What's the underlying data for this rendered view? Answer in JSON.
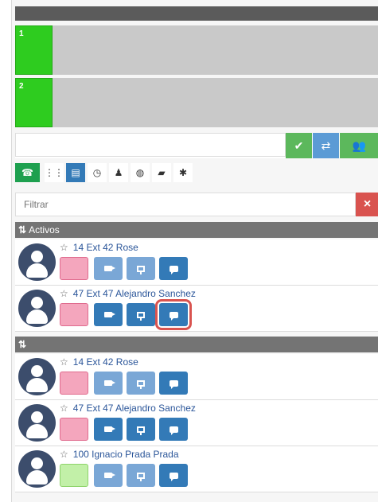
{
  "lines": [
    {
      "number": "1"
    },
    {
      "number": "2"
    }
  ],
  "dial": {
    "value": "",
    "placeholder": ""
  },
  "filter": {
    "placeholder": "Filtrar",
    "clear_label": "×"
  },
  "groups": [
    {
      "sort_label": "⇅",
      "label": "Activos",
      "contacts": [
        {
          "name": "14 Ext 42 Rose",
          "status_color": "#f4a6bd",
          "status_border": "#e06b8e",
          "video_faded": true,
          "screen_faded": true
        },
        {
          "name": "47 Ext 47 Alejandro Sanchez",
          "status_color": "#f4a6bd",
          "status_border": "#e06b8e",
          "video_faded": false,
          "screen_faded": false,
          "chat_highlighted": true
        }
      ]
    },
    {
      "sort_label": "⇅",
      "label": "",
      "contacts": [
        {
          "name": "14 Ext 42 Rose",
          "status_color": "#f4a6bd",
          "status_border": "#e06b8e",
          "video_faded": true,
          "screen_faded": true
        },
        {
          "name": "47 Ext 47 Alejandro Sanchez",
          "status_color": "#f4a6bd",
          "status_border": "#e06b8e",
          "video_faded": false,
          "screen_faded": false
        },
        {
          "name": "100 Ignacio Prada Prada",
          "status_color": "#c2f0a8",
          "status_border": "#8ed36a",
          "video_faded": true,
          "screen_faded": true
        }
      ]
    }
  ],
  "colors": {
    "line_active": "#2ecc1f",
    "accent": "#337ab7",
    "danger": "#d9534f",
    "success": "#5cb85c"
  }
}
